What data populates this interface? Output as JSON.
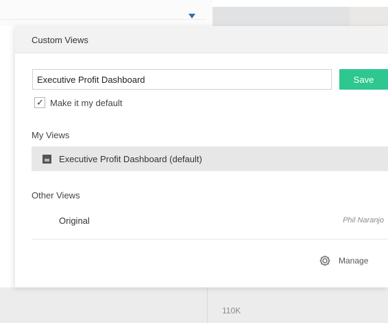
{
  "dialog": {
    "title": "Custom Views",
    "view_name_value": "Executive Profit Dashboard",
    "save_label": "Save",
    "make_default_label": "Make it my default",
    "make_default_checked": true,
    "my_views_label": "My Views",
    "my_views": [
      {
        "label": "Executive Profit Dashboard (default)",
        "icon": "dashboard-icon"
      }
    ],
    "other_views_label": "Other Views",
    "other_views": [
      {
        "name": "Original",
        "owner": "Phil Naranjo"
      }
    ],
    "manage_label": "Manage",
    "manage_icon": "gear-icon"
  },
  "background": {
    "axis_label": "110K"
  },
  "colors": {
    "save_button": "#2ec78f",
    "caret": "#2a6fb3",
    "selected_row": "#e7e7e7"
  }
}
